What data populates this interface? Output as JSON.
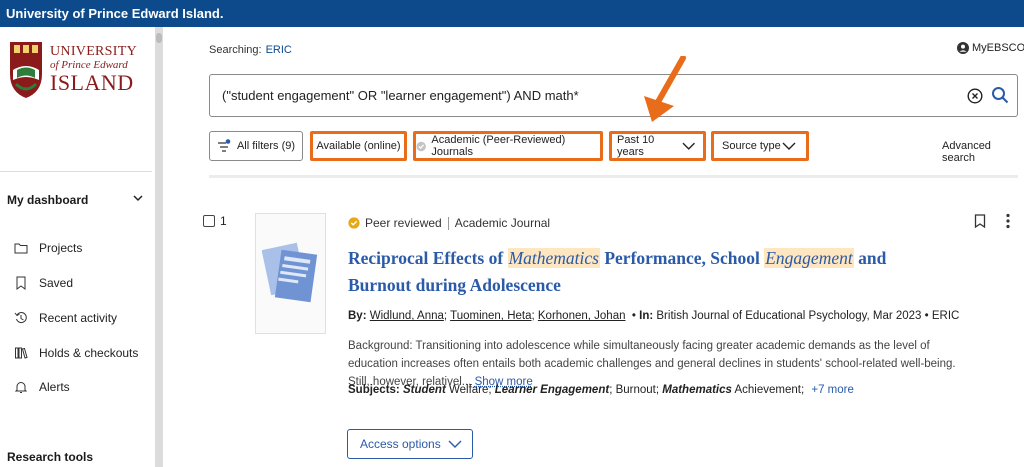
{
  "topbar": {
    "title": "University of Prince Edward Island."
  },
  "logo": {
    "line1": "UNIVERSITY",
    "line2": "of Prince Edward",
    "line3": "ISLAND"
  },
  "sidebar": {
    "dashboard_title": "My dashboard",
    "items": [
      {
        "label": "Projects",
        "icon": "folder-icon"
      },
      {
        "label": "Saved",
        "icon": "bookmark-icon"
      },
      {
        "label": "Recent activity",
        "icon": "history-icon"
      },
      {
        "label": "Holds & checkouts",
        "icon": "books-icon"
      },
      {
        "label": "Alerts",
        "icon": "bell-icon"
      }
    ],
    "research_title": "Research tools"
  },
  "search": {
    "searching_label": "Searching:",
    "database": "ERIC",
    "myebsco": "MyEBSCO",
    "query": "(\"student engagement\" OR \"learner engagement\") AND math*"
  },
  "filters": {
    "all_filters": "All filters (9)",
    "available": "Available (online)",
    "peer": "Academic (Peer-Reviewed) Journals",
    "years": "Past 10 years",
    "source_type": "Source type",
    "advanced": "Advanced search"
  },
  "colors": {
    "accent": "#0c4a8c",
    "highlight": "#e86c1a",
    "link": "#2a5aa8",
    "mark": "#fde6c0"
  },
  "result": {
    "number": "1",
    "peer_reviewed": "Peer reviewed",
    "type": "Academic Journal",
    "title": {
      "t1": "Reciprocal Effects of ",
      "m1": "Mathematics",
      "t2": " Performance, School ",
      "m2": "Engagement",
      "t3": " and Burnout during Adolescence"
    },
    "by_label": "By:",
    "authors": [
      "Widlund, Anna",
      "Tuominen, Heta",
      "Korhonen, Johan"
    ],
    "in_label": "In:",
    "source": "British Journal of Educational Psychology, Mar 2023 • ERIC",
    "abstract": "Background: Transitioning into adolescence while simultaneously facing greater academic demands as the level of education increases often entails both academic challenges and general declines in students' school-related well-being. Still, however, relativel...",
    "show_more": "Show more",
    "subjects_label": "Subjects:",
    "subjects": {
      "s1a": "Student",
      "s1b": " Welfare",
      "s2a": "Learner Engagement",
      "s3": "Burnout",
      "s4a": "Mathematics",
      "s4b": " Achievement"
    },
    "more_subjects": "+7 more",
    "access": "Access options"
  }
}
